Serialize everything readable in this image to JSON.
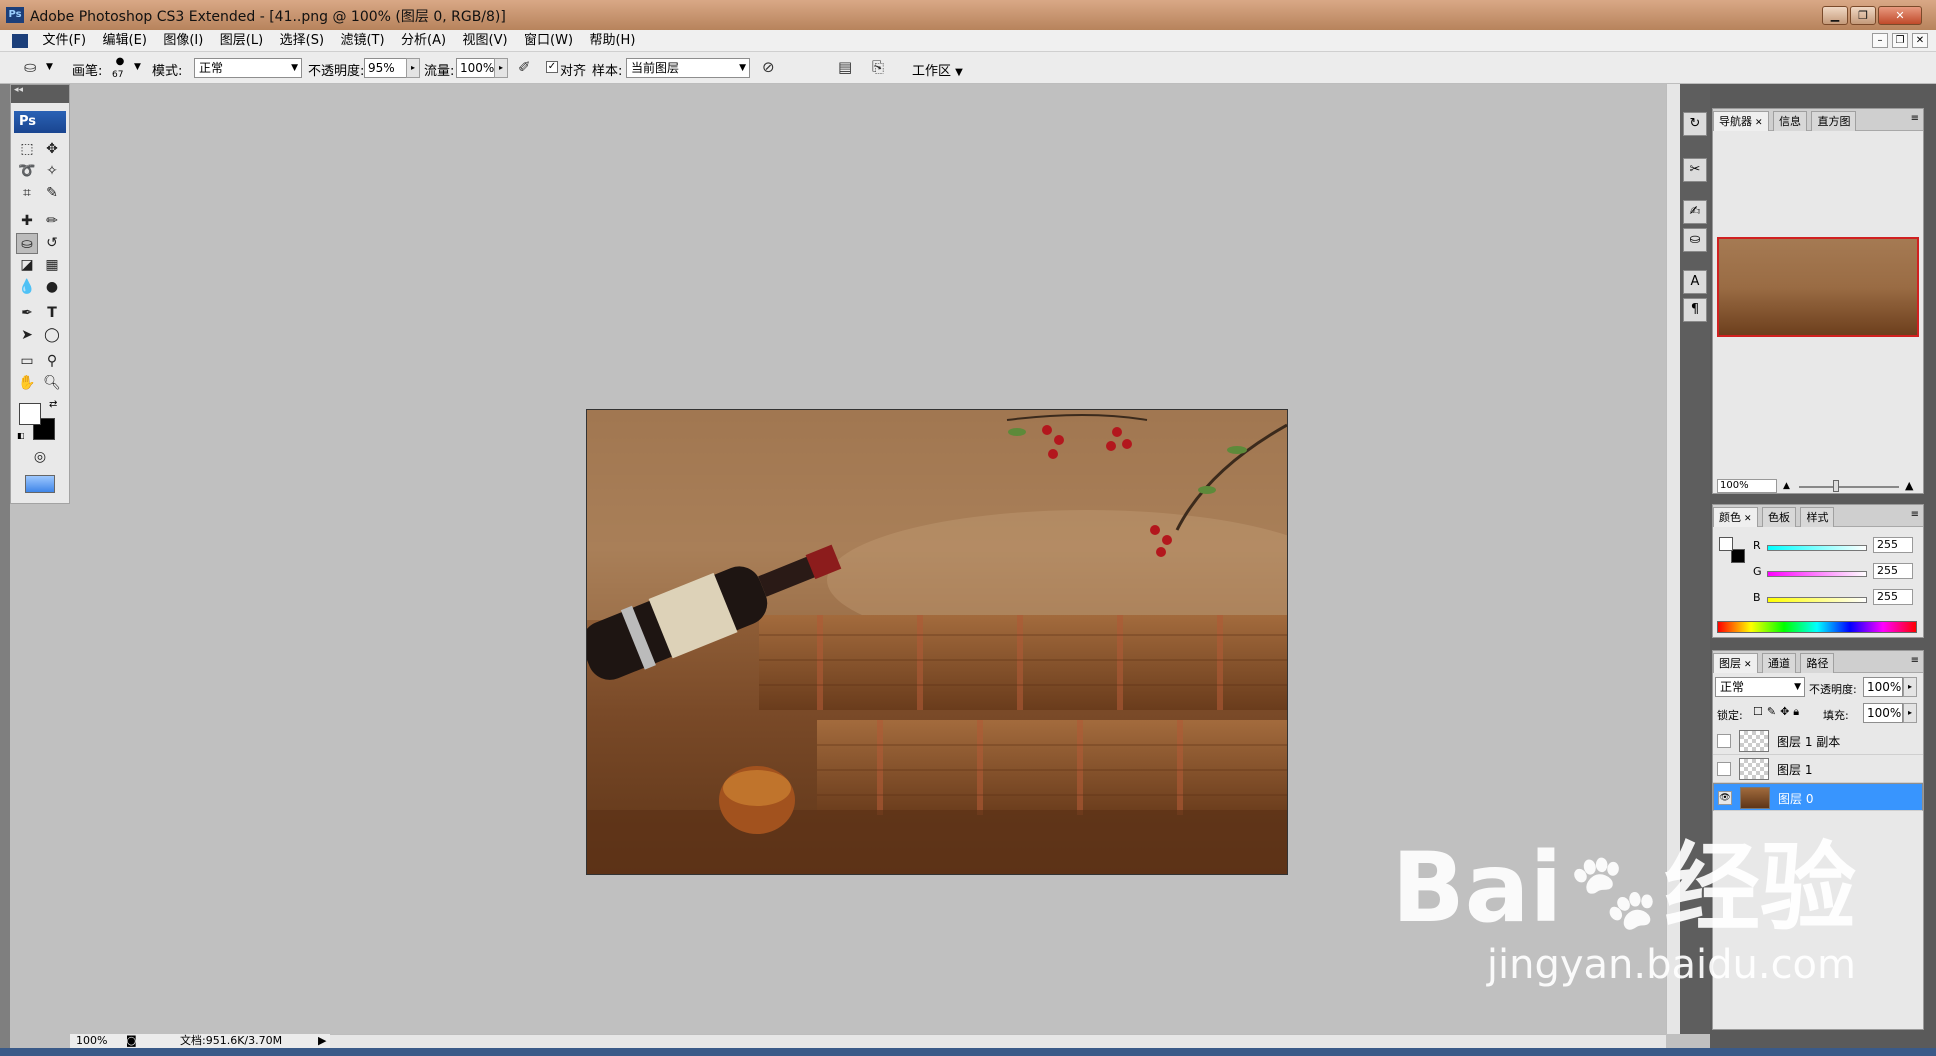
{
  "titlebar": {
    "title": "Adobe Photoshop CS3 Extended - [41..png @ 100% (图层 0, RGB/8)]",
    "ps_logo": "Ps"
  },
  "menu": [
    "文件(F)",
    "编辑(E)",
    "图像(I)",
    "图层(L)",
    "选择(S)",
    "滤镜(T)",
    "分析(A)",
    "视图(V)",
    "窗口(W)",
    "帮助(H)"
  ],
  "options": {
    "brush_label": "画笔:",
    "brush_size": "67",
    "mode_label": "模式:",
    "mode_value": "正常",
    "opacity_label": "不透明度:",
    "opacity_value": "95%",
    "flow_label": "流量:",
    "flow_value": "100%",
    "align_label": "对齐",
    "sample_label": "样本:",
    "sample_value": "当前图层",
    "workspace_label": "工作区"
  },
  "toolbox": {
    "ps_label": "Ps"
  },
  "status": {
    "zoom": "100%",
    "doc": "文档:951.6K/3.70M"
  },
  "navigator": {
    "tabs": [
      "导航器",
      "信息",
      "直方图"
    ],
    "zoom": "100%"
  },
  "color": {
    "tabs": [
      "颜色",
      "色板",
      "样式"
    ],
    "r_label": "R",
    "g_label": "G",
    "b_label": "B",
    "r": "255",
    "g": "255",
    "b": "255"
  },
  "layers": {
    "tabs": [
      "图层",
      "通道",
      "路径"
    ],
    "blend": "正常",
    "opacity_label": "不透明度:",
    "opacity": "100%",
    "lock_label": "锁定:",
    "fill_label": "填充:",
    "fill": "100%",
    "items": [
      {
        "name": "图层 1 副本"
      },
      {
        "name": "图层 1"
      },
      {
        "name": "图层 0"
      }
    ]
  },
  "watermark": {
    "brand": "Bai",
    "brand2": "经验",
    "url": "jingyan.baidu.com"
  },
  "colors": {
    "selection": "#3895fe",
    "title_bg": "#c4926c",
    "canvas_bg": "#c0c0c0"
  }
}
